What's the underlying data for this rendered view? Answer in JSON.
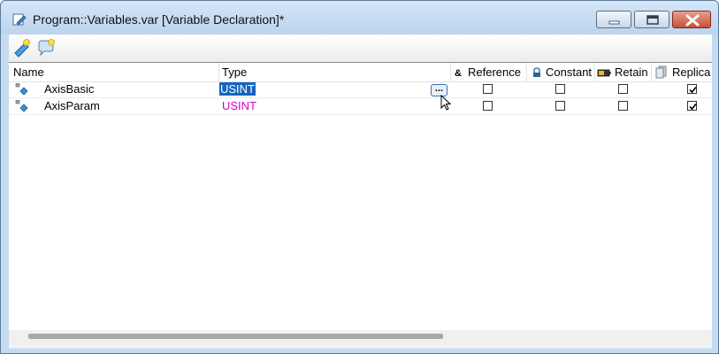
{
  "window": {
    "title": "Program::Variables.var [Variable Declaration]*"
  },
  "toolbar": {
    "icons": [
      "add-variable-icon",
      "add-comment-icon"
    ]
  },
  "columns": {
    "name": "Name",
    "type": "Type",
    "reference": "Reference",
    "constant": "Constant",
    "retain": "Retain",
    "replicable": "Replica"
  },
  "rows": [
    {
      "name": "AxisBasic",
      "type": "USINT",
      "selected": true,
      "reference": false,
      "constant": false,
      "retain": false,
      "replicable": true
    },
    {
      "name": "AxisParam",
      "type": "USINT",
      "selected": false,
      "reference": false,
      "constant": false,
      "retain": false,
      "replicable": true
    }
  ],
  "edit_button_label": "...",
  "colors": {
    "type_text": "#d400c8",
    "selection": "#1565c0",
    "title_bg": "#c4dbf2"
  },
  "scrollbar": {
    "horizontal_visible_fraction": 0.59
  }
}
